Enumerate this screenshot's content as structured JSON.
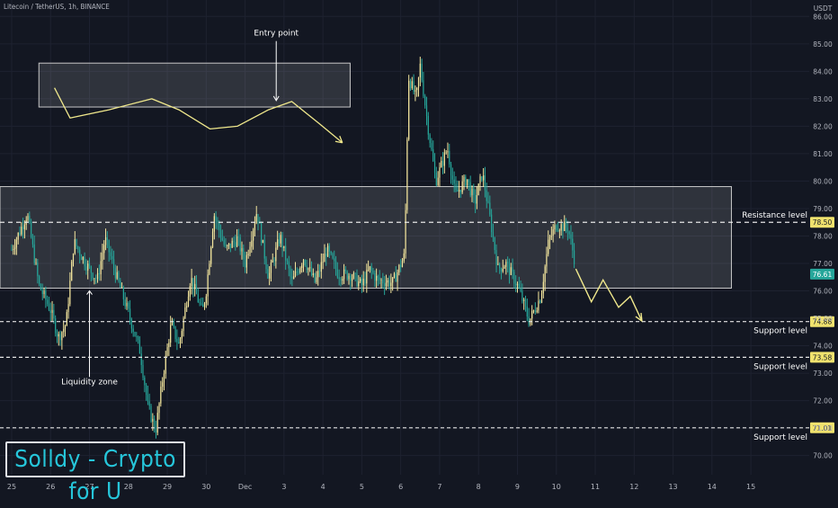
{
  "header": {
    "symbol": "Litecoin / TetherUS, 1h, BINANCE",
    "currency": "USDT"
  },
  "brand": {
    "text": "Solldy - Crypto for U"
  },
  "colors": {
    "background": "#131722",
    "grid": "#1e2230",
    "candle_up": "#f5e79e",
    "candle_down": "#26a69a",
    "level_line": "#e6e6e6",
    "badge": "#f0e26e",
    "price_badge": "#26a69a",
    "annotation": "#f0e88c",
    "zone_fill": "rgba(255,255,255,0.12)",
    "zone_border": "#c8c8c8",
    "axis_text": "#b2b5be"
  },
  "chart_data": {
    "type": "candlestick",
    "title": "Litecoin / TetherUS, 1h, BINANCE",
    "y_axis": {
      "label": "USDT",
      "ticks": [
        70.0,
        71.0,
        72.0,
        73.0,
        74.0,
        75.0,
        76.0,
        77.0,
        78.0,
        79.0,
        80.0,
        81.0,
        82.0,
        83.0,
        84.0,
        85.0,
        86.0
      ],
      "range": [
        69.3,
        86.6
      ]
    },
    "x_axis": {
      "ticks": [
        "25",
        "26",
        "27",
        "28",
        "29",
        "30",
        "Dec",
        "3",
        "4",
        "5",
        "6",
        "7",
        "8",
        "9",
        "10",
        "11",
        "12",
        "13",
        "14",
        "15"
      ],
      "range_days": [
        -0.3,
        20.5
      ]
    },
    "price_path": [
      [
        0.0,
        77.5
      ],
      [
        0.4,
        78.8
      ],
      [
        0.7,
        76.2
      ],
      [
        1.0,
        75.3
      ],
      [
        1.2,
        74.3
      ],
      [
        1.4,
        74.8
      ],
      [
        1.6,
        77.8
      ],
      [
        1.9,
        77.0
      ],
      [
        2.2,
        76.4
      ],
      [
        2.4,
        77.9
      ],
      [
        2.7,
        76.5
      ],
      [
        3.0,
        75.2
      ],
      [
        3.3,
        73.8
      ],
      [
        3.5,
        71.8
      ],
      [
        3.7,
        70.9
      ],
      [
        3.9,
        73.0
      ],
      [
        4.1,
        74.8
      ],
      [
        4.3,
        74.0
      ],
      [
        4.6,
        76.5
      ],
      [
        4.9,
        75.2
      ],
      [
        5.0,
        76.0
      ],
      [
        5.2,
        78.8
      ],
      [
        5.5,
        77.5
      ],
      [
        5.8,
        77.9
      ],
      [
        6.0,
        77.0
      ],
      [
        6.3,
        78.9
      ],
      [
        6.6,
        76.5
      ],
      [
        6.9,
        78.0
      ],
      [
        7.2,
        76.3
      ],
      [
        7.5,
        77.2
      ],
      [
        7.8,
        76.3
      ],
      [
        8.1,
        77.5
      ],
      [
        8.4,
        76.6
      ],
      [
        8.7,
        76.6
      ],
      [
        9.0,
        76.2
      ],
      [
        9.2,
        76.8
      ],
      [
        9.4,
        76.4
      ],
      [
        9.8,
        76.3
      ],
      [
        10.1,
        77.3
      ],
      [
        10.2,
        83.8
      ],
      [
        10.4,
        83.0
      ],
      [
        10.5,
        84.2
      ],
      [
        10.7,
        82.0
      ],
      [
        10.9,
        80.0
      ],
      [
        11.2,
        81.2
      ],
      [
        11.4,
        79.5
      ],
      [
        11.7,
        80.1
      ],
      [
        11.9,
        79.2
      ],
      [
        12.1,
        80.3
      ],
      [
        12.3,
        78.6
      ],
      [
        12.5,
        76.8
      ],
      [
        12.7,
        77.0
      ],
      [
        13.0,
        76.2
      ],
      [
        13.1,
        75.8
      ],
      [
        13.3,
        74.9
      ],
      [
        13.6,
        75.8
      ],
      [
        13.8,
        77.8
      ],
      [
        14.0,
        78.4
      ],
      [
        14.3,
        78.3
      ],
      [
        14.5,
        76.9
      ]
    ],
    "levels": [
      {
        "name": "Resistance level",
        "value": 78.5,
        "badge": "78.50"
      },
      {
        "name": "Support level",
        "value": 74.88,
        "badge": "74.88"
      },
      {
        "name": "Support level",
        "value": 73.58,
        "badge": "73.58"
      },
      {
        "name": "Support level",
        "value": 71.01,
        "badge": "71.01"
      }
    ],
    "last_price": {
      "value": 76.61,
      "badge": "76.61"
    },
    "zones": [
      {
        "x_start_days": -0.3,
        "x_end_days": 18.5,
        "y_low": 76.1,
        "y_high": 79.8
      },
      {
        "x_start_days": 0.7,
        "x_end_days": 8.7,
        "y_low": 82.7,
        "y_high": 84.3
      }
    ],
    "annotations": [
      {
        "text": "Entry point",
        "x_days": 6.8,
        "y": 85.3
      },
      {
        "text": "Liquidity zone",
        "x_days": 2.0,
        "y": 72.6
      }
    ],
    "projection": [
      [
        14.5,
        76.8
      ],
      [
        14.9,
        75.6
      ],
      [
        15.2,
        76.4
      ],
      [
        15.6,
        75.4
      ],
      [
        15.9,
        75.8
      ],
      [
        16.2,
        74.9
      ]
    ],
    "wave_sketch": [
      [
        1.1,
        83.4
      ],
      [
        1.5,
        82.3
      ],
      [
        2.5,
        82.6
      ],
      [
        3.6,
        83.0
      ],
      [
        4.3,
        82.6
      ],
      [
        5.1,
        81.9
      ],
      [
        5.8,
        82.0
      ],
      [
        6.6,
        82.6
      ],
      [
        7.2,
        82.9
      ],
      [
        7.9,
        82.1
      ],
      [
        8.5,
        81.4
      ]
    ]
  }
}
